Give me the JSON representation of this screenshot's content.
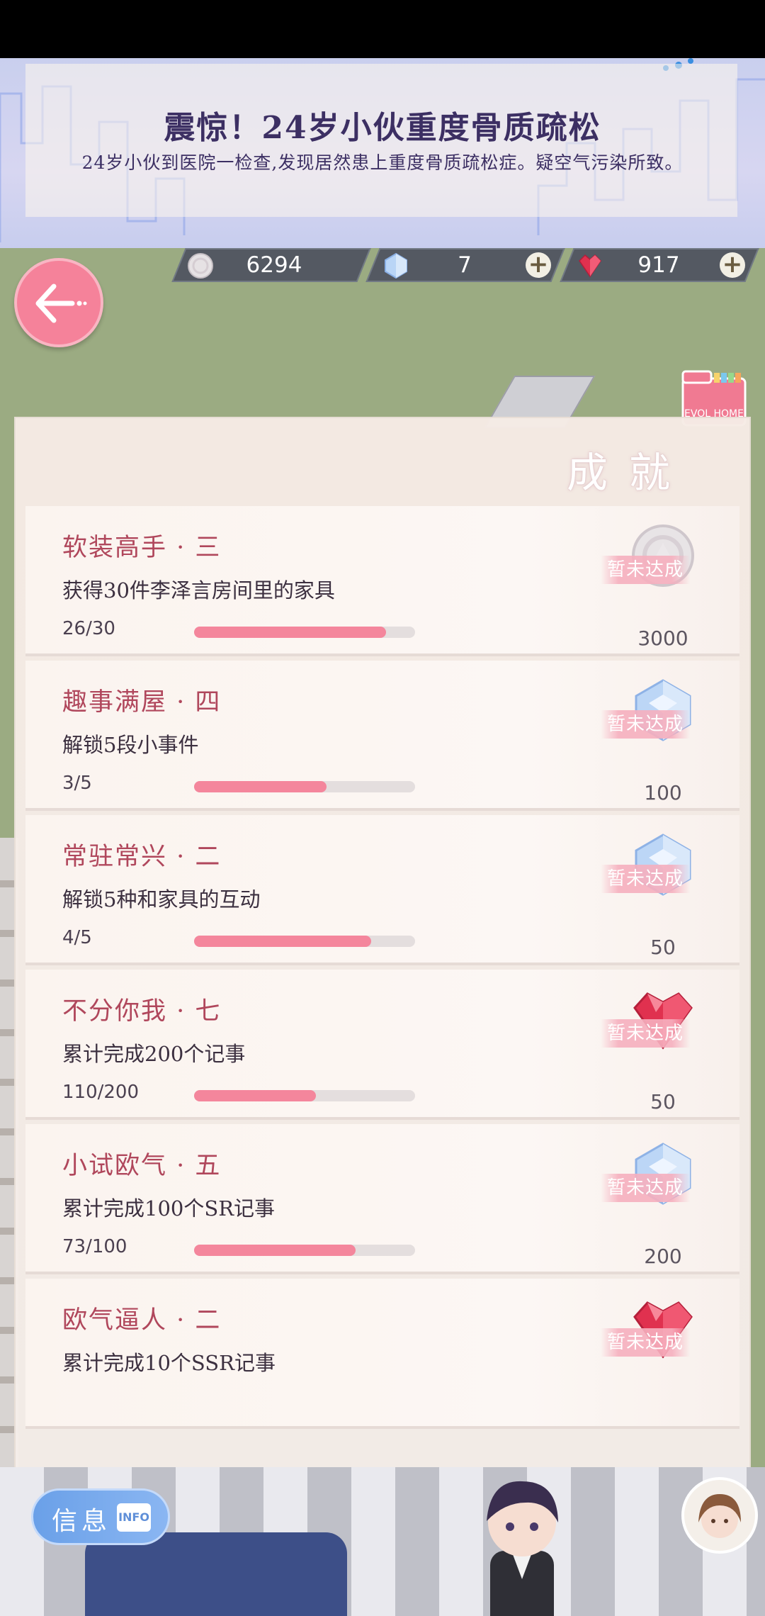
{
  "banner": {
    "title": "震惊！24岁小伙重度骨质疏松",
    "subtitle": "24岁小伙到医院一检查,发现居然患上重度骨质疏松症。疑空气污染所致。"
  },
  "currencies": {
    "coins": "6294",
    "crystals": "7",
    "gems": "917"
  },
  "panel": {
    "title": "成就",
    "folder_label": "EVOL HOME"
  },
  "achievements": [
    {
      "name": "软装高手 · 三",
      "desc": "获得30件李泽言房间里的家具",
      "progress": "26/30",
      "ratio": 0.867,
      "reward_icon": "coin-icon",
      "status": "暂未达成",
      "amount": "3000"
    },
    {
      "name": "趣事满屋 · 四",
      "desc": "解锁5段小事件",
      "progress": "3/5",
      "ratio": 0.6,
      "reward_icon": "crystal-icon",
      "status": "暂未达成",
      "amount": "100"
    },
    {
      "name": "常驻常兴 · 二",
      "desc": "解锁5种和家具的互动",
      "progress": "4/5",
      "ratio": 0.8,
      "reward_icon": "crystal-icon",
      "status": "暂未达成",
      "amount": "50"
    },
    {
      "name": "不分你我 · 七",
      "desc": "累计完成200个记事",
      "progress": "110/200",
      "ratio": 0.55,
      "reward_icon": "heart-gem-icon",
      "status": "暂未达成",
      "amount": "50"
    },
    {
      "name": "小试欧气 · 五",
      "desc": "累计完成100个SR记事",
      "progress": "73/100",
      "ratio": 0.73,
      "reward_icon": "crystal-icon",
      "status": "暂未达成",
      "amount": "200"
    },
    {
      "name": "欧气逼人 · 二",
      "desc": "累计完成10个SSR记事",
      "progress": "",
      "ratio": null,
      "reward_icon": "heart-gem-icon",
      "status": "暂未达成",
      "amount": ""
    }
  ],
  "bottom": {
    "info_label": "信息",
    "info_tag": "INFO"
  },
  "colors": {
    "accent_pink": "#f4869c",
    "title_red": "#b0475c",
    "banner_text": "#3c2f63"
  }
}
